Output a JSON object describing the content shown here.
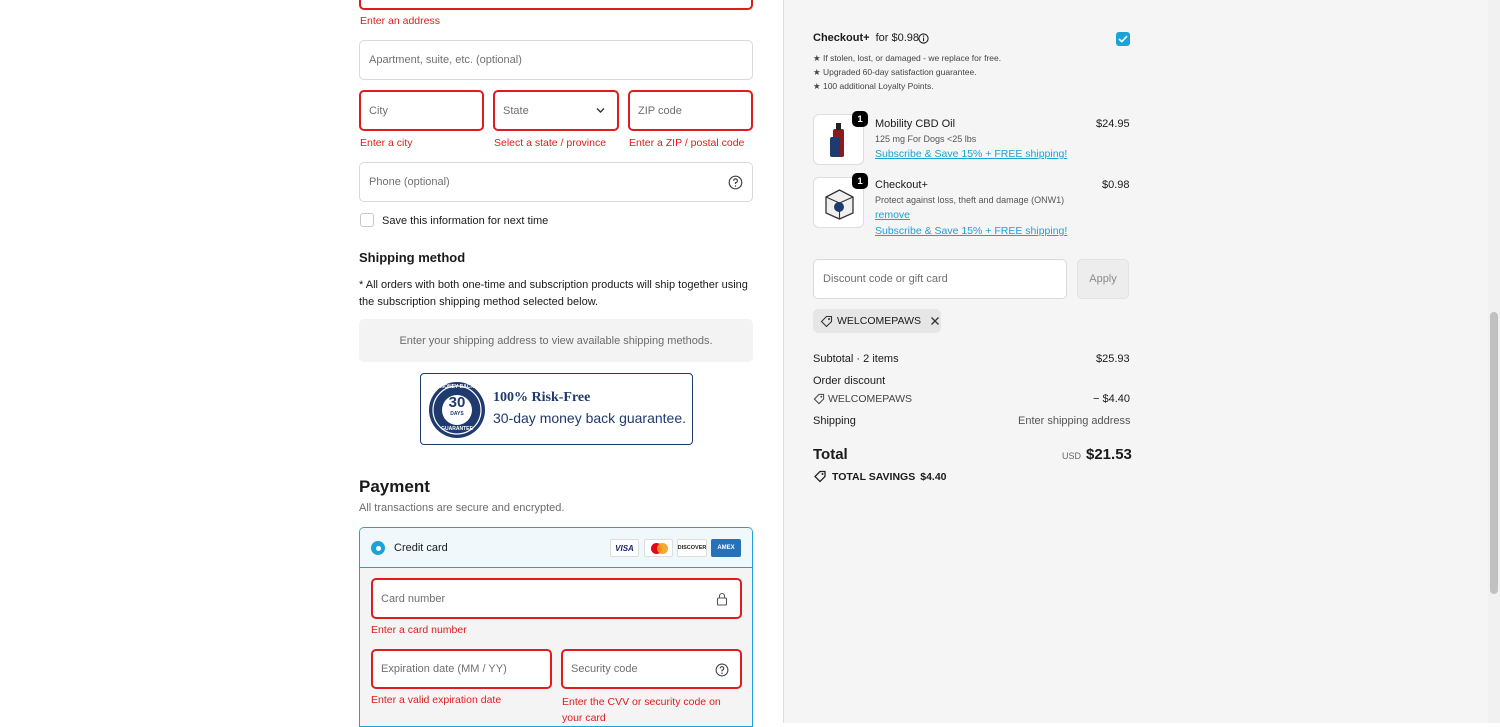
{
  "address": {
    "error": "Enter an address",
    "apartment_placeholder": "Apartment, suite, etc. (optional)",
    "city_placeholder": "City",
    "city_error": "Enter a city",
    "state_placeholder": "State",
    "state_error": "Select a state / province",
    "zip_placeholder": "ZIP code",
    "zip_error": "Enter a ZIP / postal code",
    "phone_placeholder": "Phone (optional)",
    "save_label": "Save this information for next time"
  },
  "shipping": {
    "title": "Shipping method",
    "note": "* All orders with both one-time and subscription products will ship together using the subscription shipping method selected below.",
    "placeholder": "Enter your shipping address to view available shipping methods."
  },
  "guarantee": {
    "seal_top": "MONEY BACK",
    "seal_number": "30",
    "seal_days": "DAYS",
    "seal_bottom": "GUARANTEE",
    "title": "100% Risk-Free",
    "subtitle": "30-day money back guarantee."
  },
  "payment": {
    "title": "Payment",
    "subtitle": "All transactions are secure and encrypted.",
    "method_label": "Credit card",
    "card_brands": [
      "VISA",
      "MC",
      "DISCOVER",
      "AMEX"
    ],
    "card_number_placeholder": "Card number",
    "card_number_error": "Enter a card number",
    "expiry_placeholder": "Expiration date (MM / YY)",
    "expiry_error": "Enter a valid expiration date",
    "cvv_placeholder": "Security code",
    "cvv_error_line1": "Enter the CVV or security code on",
    "cvv_error_line2": "your card"
  },
  "checkoutplus": {
    "title": "Checkout+",
    "price_text": "for $0.98",
    "checked": true,
    "bullets": [
      "★ If stolen, lost, or damaged - we replace for free.",
      "★ Upgraded 60-day satisfaction guarantee.",
      "★ 100 additional Loyalty Points."
    ]
  },
  "items": [
    {
      "qty": "1",
      "name": "Mobility CBD Oil",
      "variant": "125 mg For Dogs <25 lbs",
      "link": "Subscribe & Save 15% + FREE shipping!",
      "price": "$24.95"
    },
    {
      "qty": "1",
      "name": "Checkout+",
      "variant": "Protect against loss, theft and damage (ONW1)",
      "remove": "remove",
      "link": "Subscribe & Save 15% + FREE shipping!",
      "price": "$0.98"
    }
  ],
  "discount": {
    "placeholder": "Discount code or gift card",
    "apply_label": "Apply",
    "applied_code": "WELCOMEPAWS"
  },
  "summary": {
    "subtotal_label": "Subtotal · 2 items",
    "subtotal_value": "$25.93",
    "order_discount_label": "Order discount",
    "discount_code": "WELCOMEPAWS",
    "discount_value": "− $4.40",
    "shipping_label": "Shipping",
    "shipping_value": "Enter shipping address",
    "total_label": "Total",
    "currency": "USD",
    "total_value": "$21.53",
    "savings_label": "TOTAL SAVINGS",
    "savings_value": "$4.40"
  },
  "colors": {
    "error": "#dd1d1d",
    "accent": "#1ba2d6",
    "panel": "#f5f5f5"
  }
}
